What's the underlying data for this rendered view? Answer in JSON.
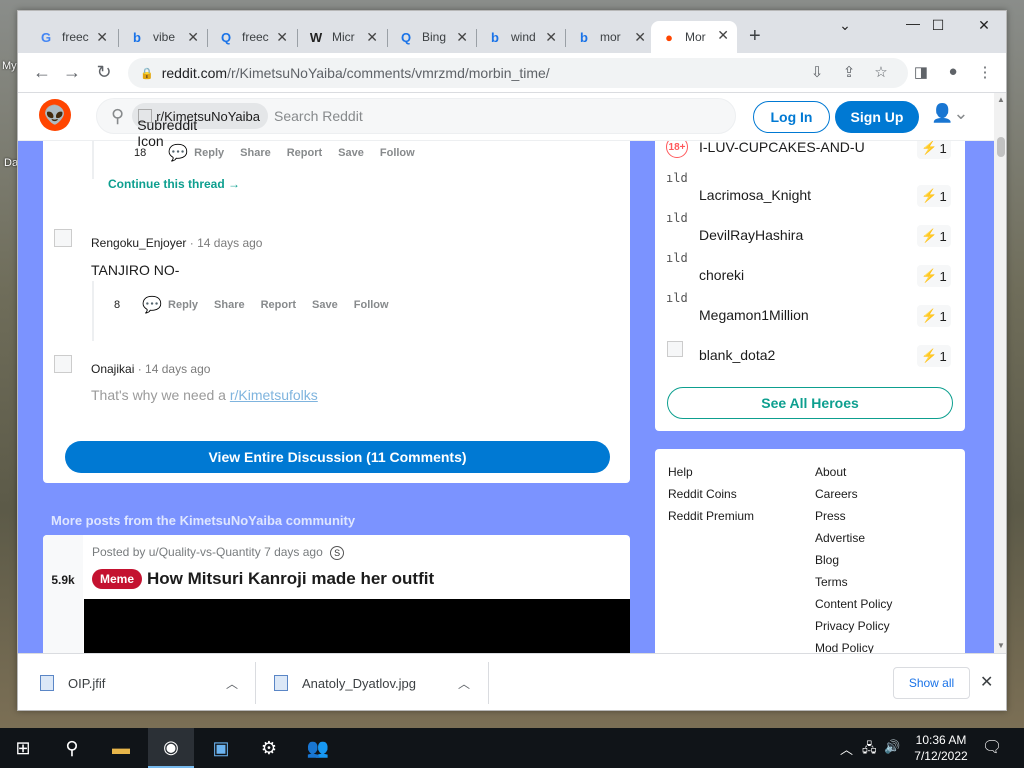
{
  "desktop": {
    "labels": [
      "My",
      "Da"
    ]
  },
  "browser": {
    "tabs": [
      {
        "icon": "google-icon",
        "glyph": "G",
        "title": "freec",
        "color": "#4285f4"
      },
      {
        "icon": "bing-icon",
        "glyph": "b",
        "title": "vibe",
        "color": "#1a73e8"
      },
      {
        "icon": "search-icon",
        "glyph": "Q",
        "title": "freec",
        "color": "#1a73e8"
      },
      {
        "icon": "wikipedia-icon",
        "glyph": "W",
        "title": "Micr",
        "color": "#222"
      },
      {
        "icon": "search-icon",
        "glyph": "Q",
        "title": "Bing",
        "color": "#1a73e8"
      },
      {
        "icon": "bing-icon",
        "glyph": "b",
        "title": "wind",
        "color": "#1a73e8"
      },
      {
        "icon": "bing-icon",
        "glyph": "b",
        "title": "mor",
        "color": "#1a73e8"
      },
      {
        "icon": "reddit-icon",
        "glyph": "●",
        "title": "Mor",
        "color": "#ff4500",
        "active": true
      }
    ],
    "url_domain": "reddit.com",
    "url_path": "/r/KimetsuNoYaiba/comments/vmrzmd/morbin_time/"
  },
  "reddit": {
    "search_chip": "r/KimetsuNoYaiba",
    "search_chip_alt": "Subreddit Icon",
    "search_placeholder": "Search Reddit",
    "login_label": "Log In",
    "signup_label": "Sign Up",
    "comments": {
      "first_count": "18",
      "actions": [
        "Reply",
        "Share",
        "Report",
        "Save",
        "Follow"
      ],
      "continue_thread": "Continue this thread →",
      "c2_author": "Rengoku_Enjoyer",
      "c2_time": "14 days ago",
      "c2_text": "TANJIRO NO-",
      "c2_count": "8",
      "c3_author": "Onajikai",
      "c3_time": "14 days ago",
      "c3_text": "That's why we need a ",
      "c3_link": "r/Kimetsufolks",
      "view_discussion": "View Entire Discussion (11 Comments)"
    },
    "more_posts_heading": "More posts from the KimetsuNoYaiba community",
    "post": {
      "votes": "5.9k",
      "meta": "Posted by u/Quality-vs-Quantity 7 days ago",
      "flair": "Meme",
      "title": "How Mitsuri Kanroji made her outfit"
    },
    "heroes": [
      {
        "name": "I-LUV-CUPCAKES-AND-U",
        "karma": "1",
        "avatar": "18+"
      },
      {
        "name": "Lacrimosa_Knight",
        "karma": "1",
        "avatar": "ıld"
      },
      {
        "name": "DevilRayHashira",
        "karma": "1",
        "avatar": "ıld"
      },
      {
        "name": "choreki",
        "karma": "1",
        "avatar": "ıld"
      },
      {
        "name": "Megamon1Million",
        "karma": "1",
        "avatar": "ıld"
      },
      {
        "name": "blank_dota2",
        "karma": "1",
        "avatar": ""
      }
    ],
    "see_all_heroes": "See All Heroes",
    "footer_left": [
      "Help",
      "Reddit Coins",
      "Reddit Premium"
    ],
    "footer_right": [
      "About",
      "Careers",
      "Press",
      "Advertise",
      "Blog",
      "Terms",
      "Content Policy",
      "Privacy Policy",
      "Mod Policy"
    ]
  },
  "downloads": {
    "items": [
      "OIP.jfif",
      "Anatoly_Dyatlov.jpg"
    ],
    "show_all": "Show all"
  },
  "taskbar": {
    "time": "10:36 AM",
    "date": "7/12/2022"
  }
}
